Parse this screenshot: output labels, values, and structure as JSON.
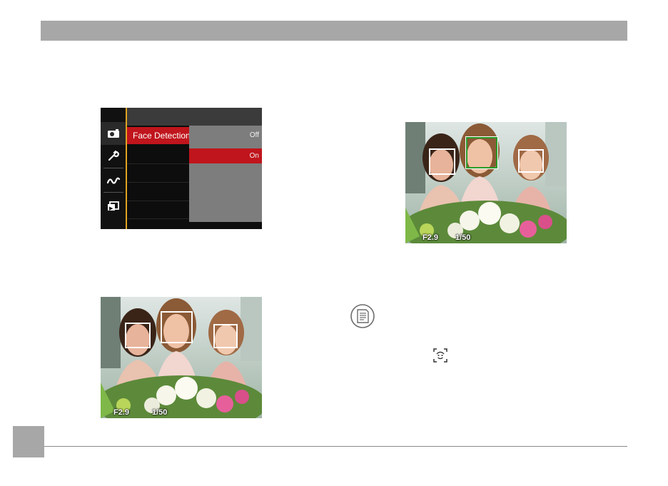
{
  "menu": {
    "selected_item": "Face Detection",
    "options": [
      "Off",
      "On"
    ],
    "highlighted_option": "On",
    "icons": [
      "camera-icon",
      "wrench-icon",
      "wave-icon",
      "playback-icon"
    ]
  },
  "photo_top": {
    "aperture": "F2.9",
    "shutter": "1/50"
  },
  "photo_bottom": {
    "aperture": "F2.9",
    "shutter": "1/50"
  },
  "icons": {
    "note": "note-icon",
    "face_detection": "face-detection-icon"
  },
  "colors": {
    "header_gray": "#a7a7a7",
    "menu_red": "#c0151c",
    "menu_accent": "#e0a31f",
    "focus_green": "#2a9b2a"
  }
}
